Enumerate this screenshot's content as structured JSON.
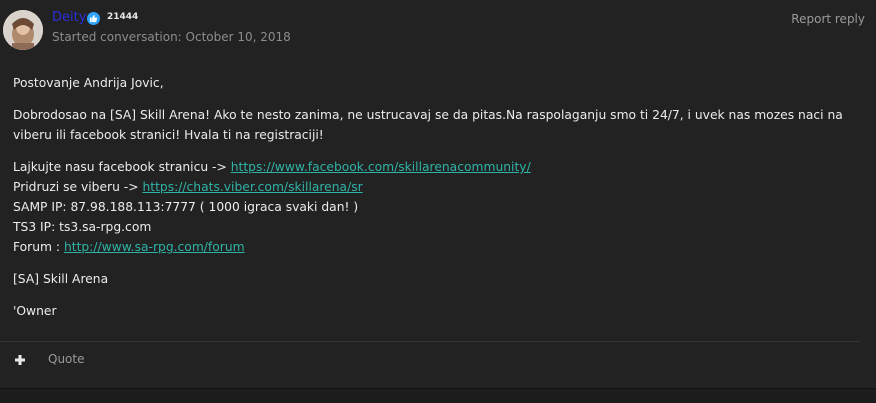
{
  "post": {
    "author": "Deity",
    "author_color": "#2a2fd8",
    "reputation": "21444",
    "started": "Started conversation: October 10, 2018",
    "report_label": "Report reply",
    "badge_icon": "thumbs-up-icon",
    "link_color": "#2fb3a6"
  },
  "body": {
    "greeting": "Postovanje Andrija Jovic,",
    "welcome": "Dobrodosao na [SA] Skill Arena! Ako te nesto zanima, ne ustrucavaj se da pitas.Na raspolaganju smo ti 24/7, i uvek nas mozes naci na viberu ili facebook stranici!  Hvala ti na registraciji!",
    "facebook_prefix": "Lajkujte nasu facebook stranicu -> ",
    "facebook_url": "https://www.facebook.com/skillarenacommunity/",
    "viber_prefix": "Pridruzi se viberu -> ",
    "viber_url": "https://chats.viber.com/skillarena/sr",
    "samp": "SAMP IP: 87.98.188.113:7777 ( 1000 igraca svaki dan! )",
    "ts3": "TS3 IP: ts3.sa-rpg.com",
    "forum_prefix": "Forum : ",
    "forum_url": "http://www.sa-rpg.com/forum",
    "signature": "[SA] Skill Arena",
    "role": "'Owner"
  },
  "footer": {
    "plus_icon": "plus-icon",
    "quote_label": "Quote"
  }
}
